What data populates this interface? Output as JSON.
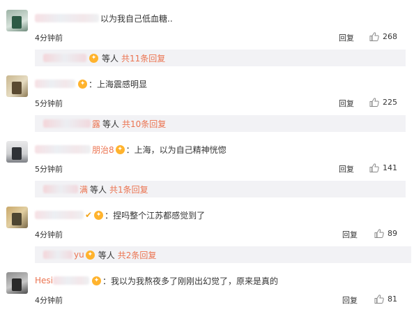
{
  "comments": [
    {
      "name_visible": "",
      "text": "以为我自己低血糖..",
      "time": "4分钟前",
      "reply_label": "回复",
      "likes": "268",
      "sub_name_visible": "",
      "sub_suffix": "等人",
      "sub_count": "共11条回复"
    },
    {
      "name_visible": "",
      "text": "：上海震感明显",
      "time": "5分钟前",
      "reply_label": "回复",
      "likes": "225",
      "sub_name_visible": "露",
      "sub_suffix": "等人",
      "sub_count": "共10条回复"
    },
    {
      "name_visible": "朋治8",
      "text": "：上海，以为自己精神恍惚",
      "time": "5分钟前",
      "reply_label": "回复",
      "likes": "141",
      "sub_name_visible": "满",
      "sub_suffix": "等人",
      "sub_count": "共1条回复"
    },
    {
      "name_visible": "",
      "text": "：捏吗整个江苏都感觉到了",
      "time": "4分钟前",
      "reply_label": "回复",
      "likes": "89",
      "sub_name_visible": "yu",
      "sub_suffix": "等人",
      "sub_count": "共2条回复"
    },
    {
      "name_visible": "Hesi",
      "text": "：我以为我熬夜多了刚刚出幻觉了，原来是真的",
      "time": "4分钟前",
      "reply_label": "回复",
      "likes": "81"
    }
  ],
  "colors": {
    "accent": "#eb7350",
    "badge": "#ffb32d",
    "reply_bg": "#f2f2f5"
  },
  "icons": {
    "like": "thumbs-up-icon",
    "badge": "fan-badge-icon",
    "verified": "checkmark-icon"
  }
}
